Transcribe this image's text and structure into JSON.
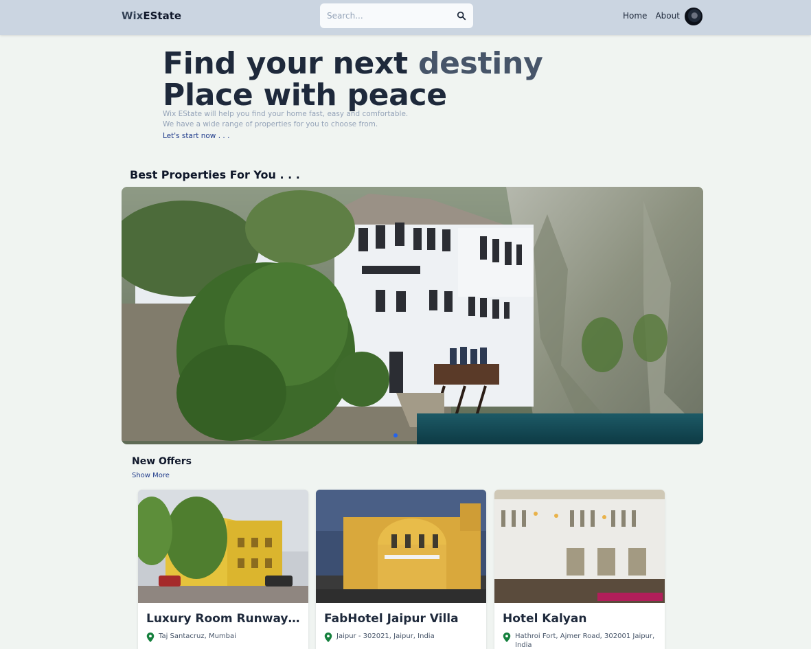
{
  "navbar": {
    "brand_prefix": "Wix",
    "brand_suffix": "EState",
    "search_placeholder": "Search...",
    "links": [
      "Home",
      "About"
    ]
  },
  "hero": {
    "line1": "Find your next ",
    "line1_accent": "destiny",
    "line2": "Place with peace",
    "desc1": "Wix EState will help you find your home fast, easy and comfortable.",
    "desc2": "We have a wide range of properties for you to choose from.",
    "cta": "Let's start now . . ."
  },
  "featured": {
    "title": "Best Properties For You . . ."
  },
  "offers": {
    "title": "New Offers",
    "show_more": "Show More",
    "cards": [
      {
        "title": "Luxury Room Runway V...",
        "location": "Taj Santacruz, Mumbai"
      },
      {
        "title": "FabHotel Jaipur Villa",
        "location": "Jaipur - 302021, Jaipur, India"
      },
      {
        "title": "Hotel Kalyan",
        "location": "Hathroi Fort, Ajmer Road, 302001 Jaipur, India"
      }
    ]
  },
  "colors": {
    "navbar_bg": "#cbd5e1",
    "page_bg": "#f0f4f1",
    "link_accent": "#1e3a8a",
    "pin_green": "#15803d"
  }
}
